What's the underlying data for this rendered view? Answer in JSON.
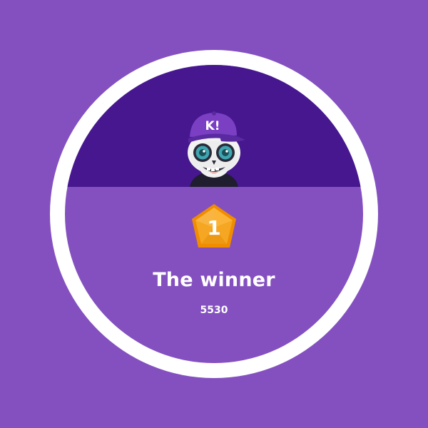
{
  "avatar": {
    "icon": "skull-avatar-with-cap-icon",
    "cap_text": "K!"
  },
  "podium": {
    "rank": "1",
    "title": "The winner",
    "score": "5530"
  },
  "colors": {
    "background": "#8450c0",
    "header_band": "#46178f",
    "ring": "#ffffff",
    "medal_gold": "#f5a623"
  }
}
